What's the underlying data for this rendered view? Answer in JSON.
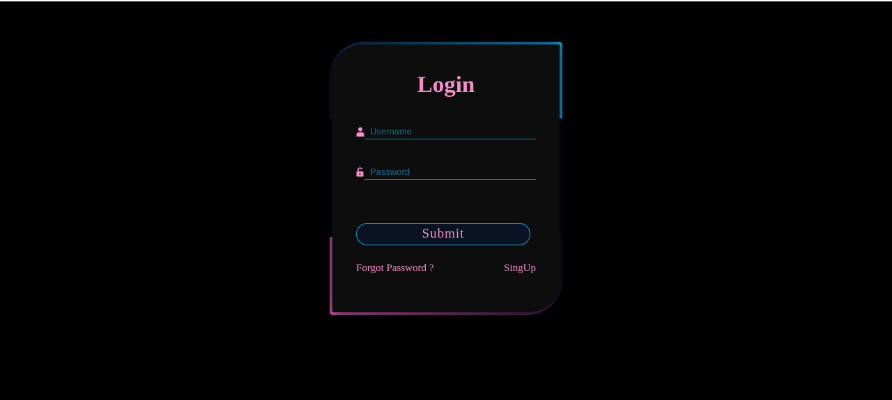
{
  "login": {
    "title": "Login",
    "username_placeholder": "Username",
    "password_placeholder": "Password",
    "submit_label": "Submit",
    "forgot_label": "Forgot Password ?",
    "signup_label": "SingUp",
    "icons": {
      "username": "user-icon",
      "password": "unlock-icon"
    },
    "colors": {
      "accent_pink": "#f58ecb",
      "accent_blue": "#1fa3d6",
      "card_bg": "#0d0d0d",
      "page_bg": "#000000"
    }
  }
}
